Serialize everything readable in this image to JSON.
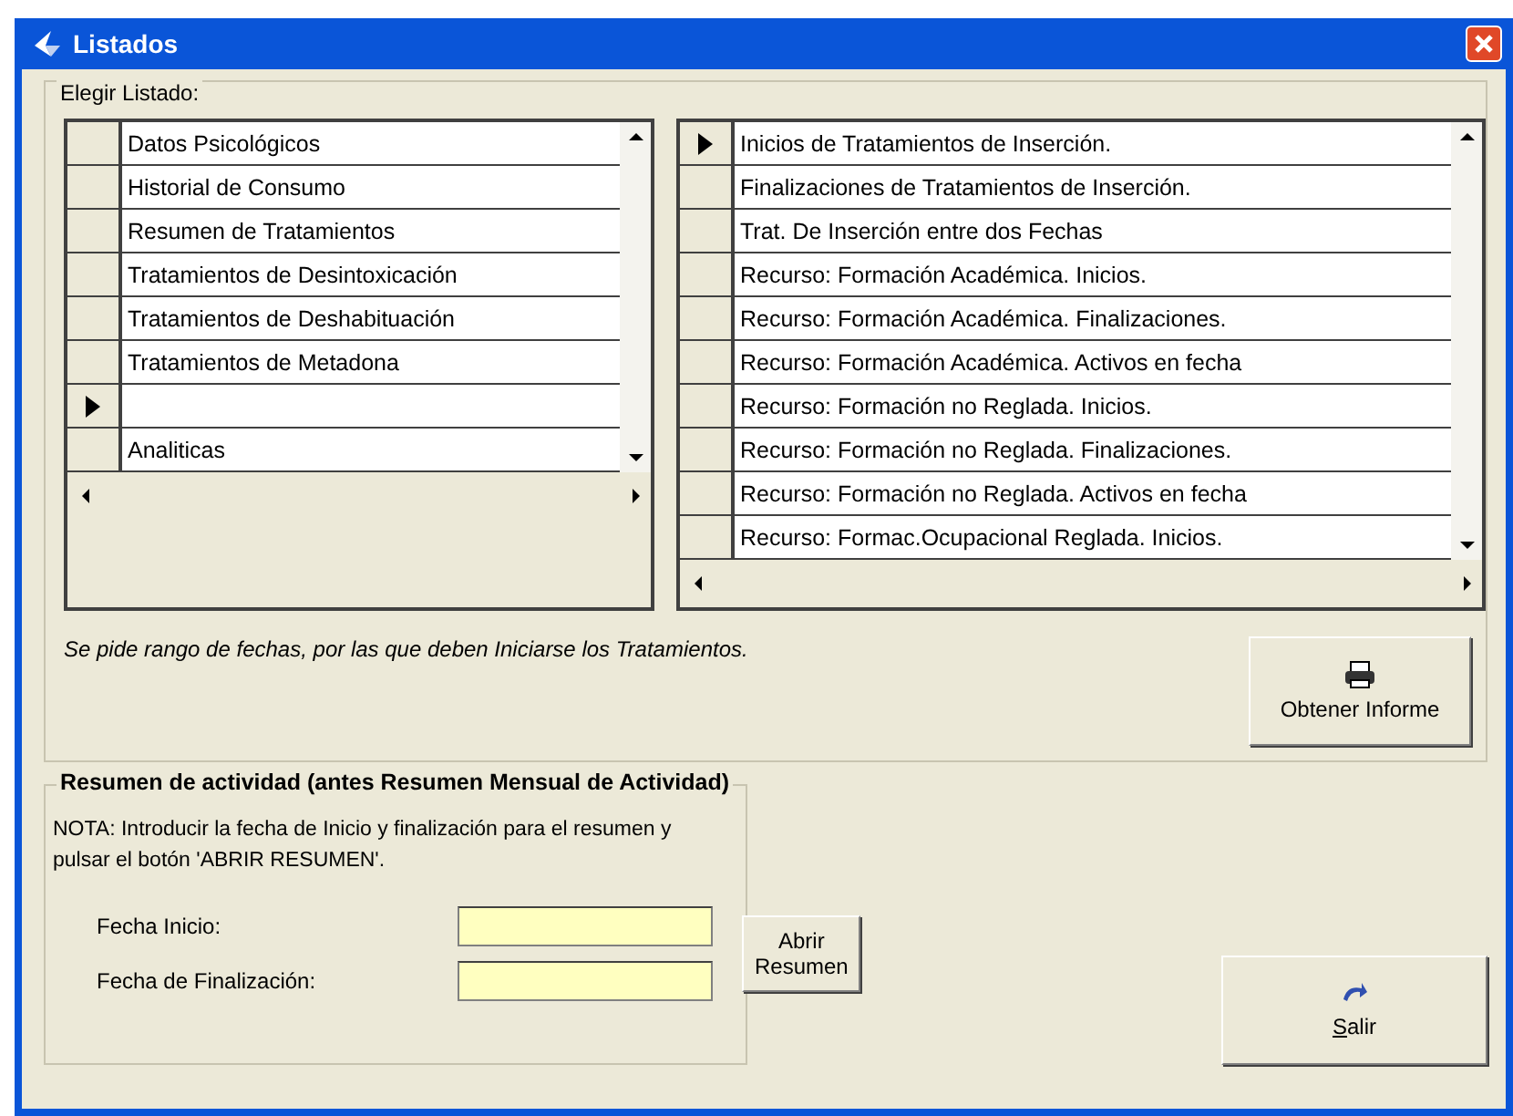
{
  "window": {
    "title": "Listados"
  },
  "group": {
    "title": "Elegir Listado:"
  },
  "left_list": {
    "rows": [
      {
        "text": "Datos Psicológicos",
        "current": false
      },
      {
        "text": "Historial de Consumo",
        "current": false
      },
      {
        "text": "Resumen de Tratamientos",
        "current": false
      },
      {
        "text": "Tratamientos de Desintoxicación",
        "current": false
      },
      {
        "text": "Tratamientos de Deshabituación",
        "current": false
      },
      {
        "text": "Tratamientos de Metadona",
        "current": false
      },
      {
        "current": true
      },
      {
        "text": "Analiticas",
        "current": false
      }
    ]
  },
  "right_list": {
    "rows": [
      {
        "text": "Inicios de Tratamientos de Inserción.",
        "current": true
      },
      {
        "text": "Finalizaciones de Tratamientos de Inserción.",
        "current": false
      },
      {
        "text": "Trat. De Inserción entre dos Fechas",
        "current": false
      },
      {
        "text": "Recurso: Formación Académica. Inicios.",
        "current": false
      },
      {
        "text": "Recurso: Formación Académica. Finalizaciones.",
        "current": false
      },
      {
        "text": "Recurso: Formación Académica. Activos en fecha",
        "current": false
      },
      {
        "text": "Recurso: Formación no Reglada. Inicios.",
        "current": false
      },
      {
        "text": "Recurso: Formación no Reglada. Finalizaciones.",
        "current": false
      },
      {
        "text": "Recurso: Formación no Reglada. Activos en fecha",
        "current": false
      },
      {
        "text": "Recurso: Formac.Ocupacional Reglada. Inicios.",
        "current": false
      }
    ]
  },
  "hint": "Se pide rango de fechas, por las que deben Iniciarse los Tratamientos.",
  "report_button": "Obtener Informe",
  "summary": {
    "title": "Resumen de actividad (antes Resumen Mensual de Actividad)",
    "note": "NOTA: Introducir la fecha de Inicio y finalización  para el resumen y pulsar el botón  'ABRIR RESUMEN'.",
    "fields": [
      {
        "label": "Fecha Inicio:"
      },
      {
        "label": "Fecha de Finalización:"
      }
    ],
    "button": "Abrir Resumen"
  },
  "exit_button": "Salir"
}
